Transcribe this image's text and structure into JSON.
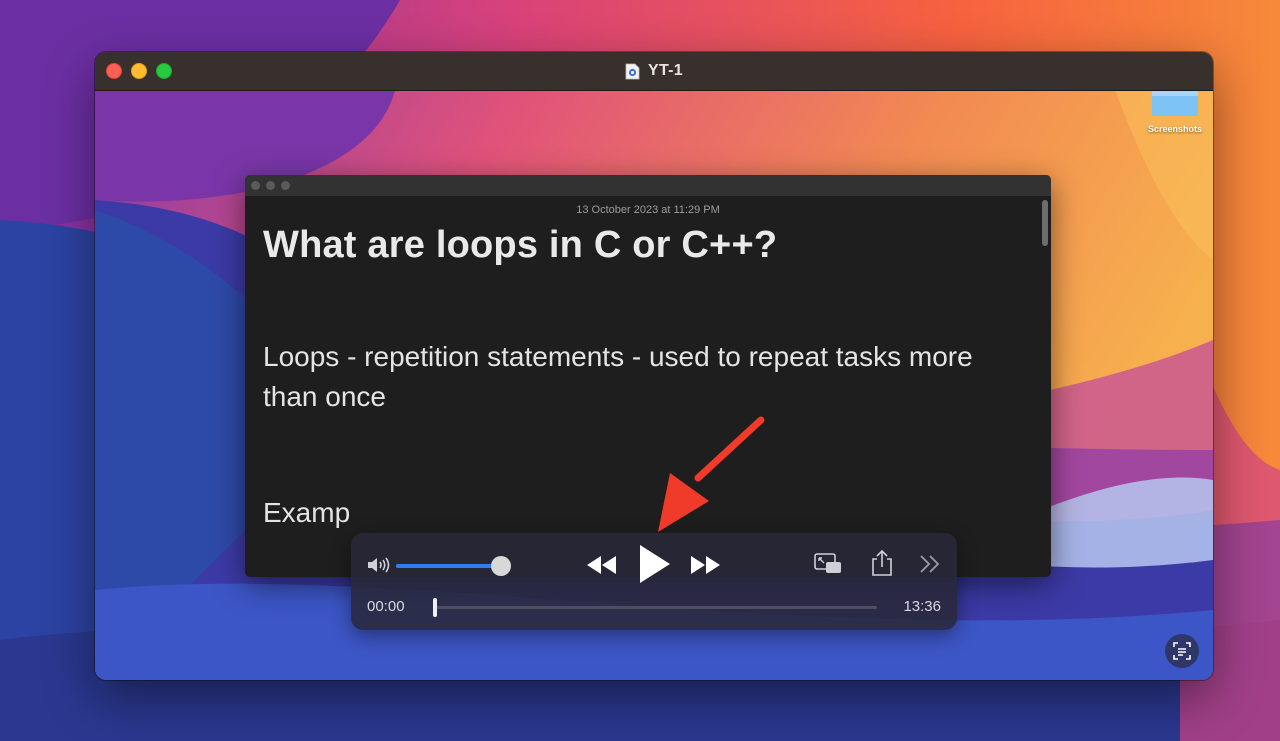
{
  "window": {
    "title": "YT-1",
    "icon": "quicktime-document-icon"
  },
  "desktop": {
    "folder_label": "Screenshots",
    "folder_icon": "folder-icon"
  },
  "video_frame": {
    "notes": {
      "date": "13 October 2023 at 11:29 PM",
      "heading": "What are loops in C or C++?",
      "body": "Loops - repetition statements - used to repeat tasks more than once",
      "example": "Examp"
    }
  },
  "player": {
    "volume_level": 0.95,
    "current_time": "00:00",
    "duration": "13:36",
    "progress": 0,
    "buttons": [
      "rewind-icon",
      "play-icon",
      "fast-forward-icon",
      "picture-in-picture-icon",
      "share-icon",
      "more-icon"
    ]
  },
  "annotation": {
    "arrow_color": "#f03a2a",
    "points_to": "play-button"
  },
  "colors": {
    "titlebar": "#38302c",
    "accent": "#2f7bf5",
    "controls_bg": "#282838"
  }
}
